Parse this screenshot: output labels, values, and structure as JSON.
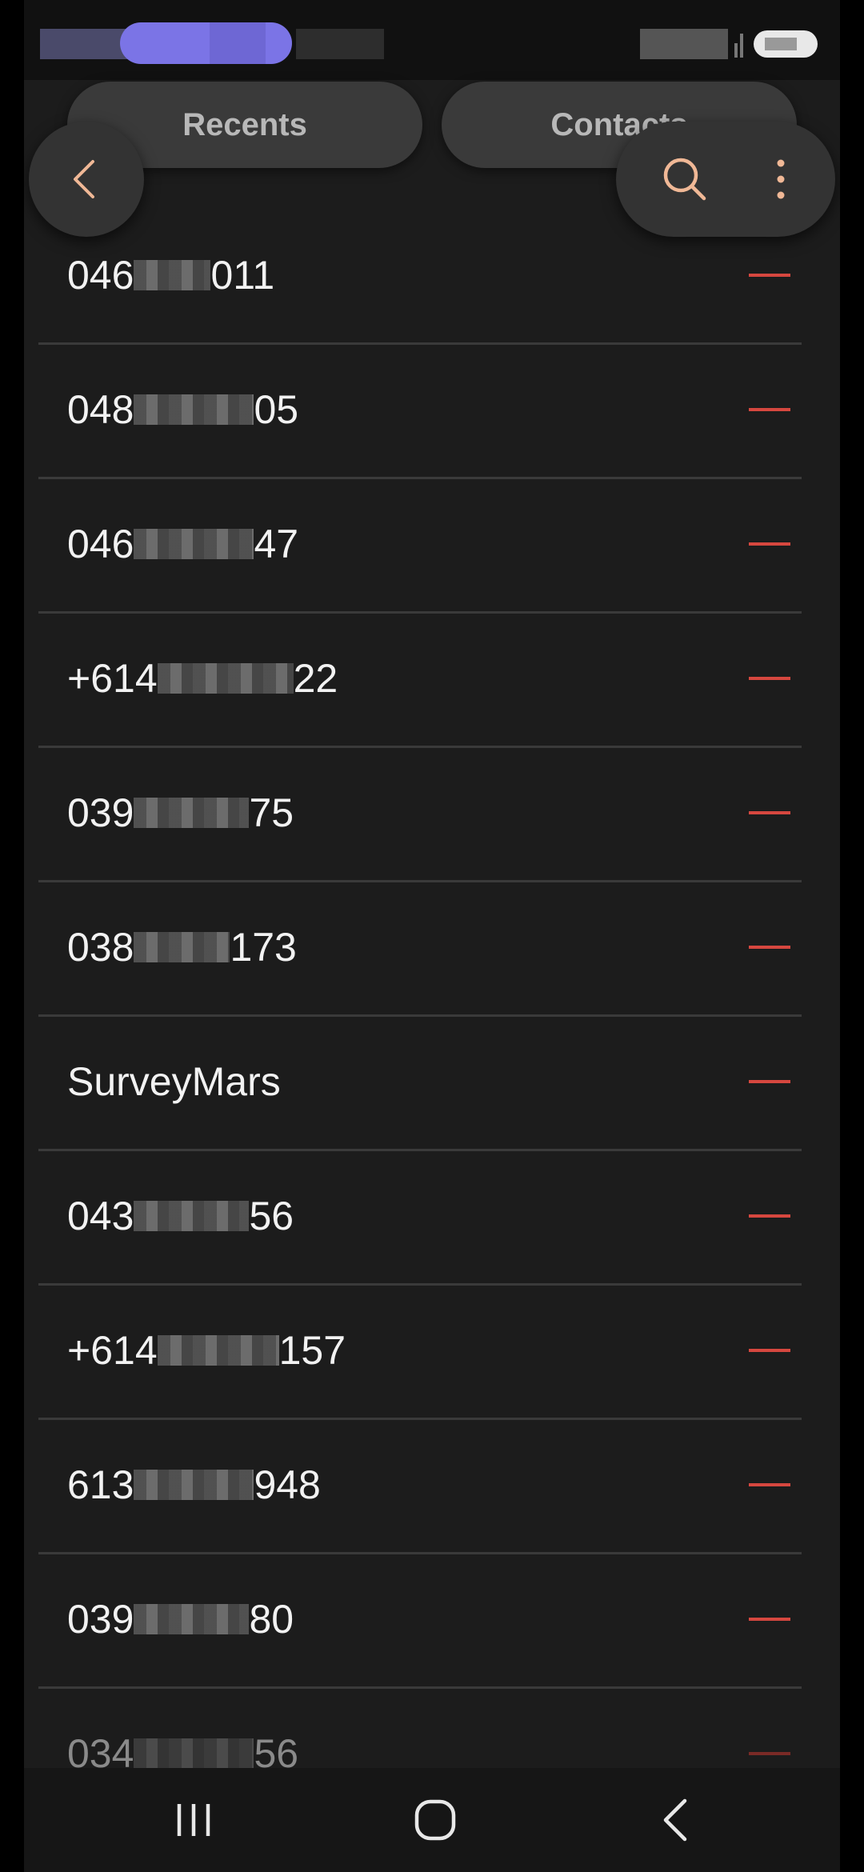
{
  "tabs": {
    "recents": "Recents",
    "contacts": "Contacts"
  },
  "toolbar": {
    "back_icon": "chevron-left-icon",
    "search_icon": "search-icon",
    "more_icon": "more-vertical-icon"
  },
  "blocked_numbers": [
    {
      "prefix": "046",
      "suffix": "011"
    },
    {
      "prefix": "048",
      "suffix": "05"
    },
    {
      "prefix": "046",
      "suffix": "47"
    },
    {
      "prefix": "+614",
      "suffix": "22"
    },
    {
      "prefix": "039",
      "suffix": "75"
    },
    {
      "prefix": "038",
      "suffix": "173"
    },
    {
      "prefix": "SurveyMars",
      "suffix": ""
    },
    {
      "prefix": "043",
      "suffix": "56"
    },
    {
      "prefix": "+614",
      "suffix": "157"
    },
    {
      "prefix": "613",
      "suffix": "948"
    },
    {
      "prefix": "039",
      "suffix": "80"
    },
    {
      "prefix": "034",
      "suffix": "56"
    }
  ],
  "colors": {
    "background": "#1c1c1c",
    "remove_accent": "#d6473f",
    "icon_accent": "#f0b896"
  }
}
